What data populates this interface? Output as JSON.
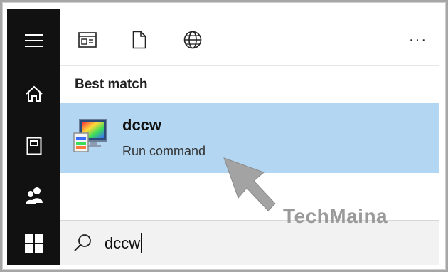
{
  "rail": {
    "items": [
      {
        "icon": "hamburger-menu-icon"
      },
      {
        "icon": "home-icon"
      },
      {
        "icon": "documents-icon"
      },
      {
        "icon": "people-icon"
      },
      {
        "icon": "windows-start-icon"
      }
    ]
  },
  "toolbar": {
    "filters": [
      {
        "icon": "apps-filter-icon"
      },
      {
        "icon": "documents-filter-icon"
      },
      {
        "icon": "web-filter-icon"
      }
    ],
    "more_label": "···"
  },
  "best_match": {
    "heading": "Best match",
    "result": {
      "title": "dccw",
      "subtitle": "Run command",
      "icon": "display-color-calibration-icon"
    }
  },
  "search": {
    "value": "dccw",
    "icon": "search-icon"
  },
  "watermark": "TechMaina",
  "colors": {
    "rail_bg": "#111111",
    "highlight": "#b3d7f2",
    "search_bg": "#f2f2f2",
    "page_bg": "#a6a6a6"
  }
}
